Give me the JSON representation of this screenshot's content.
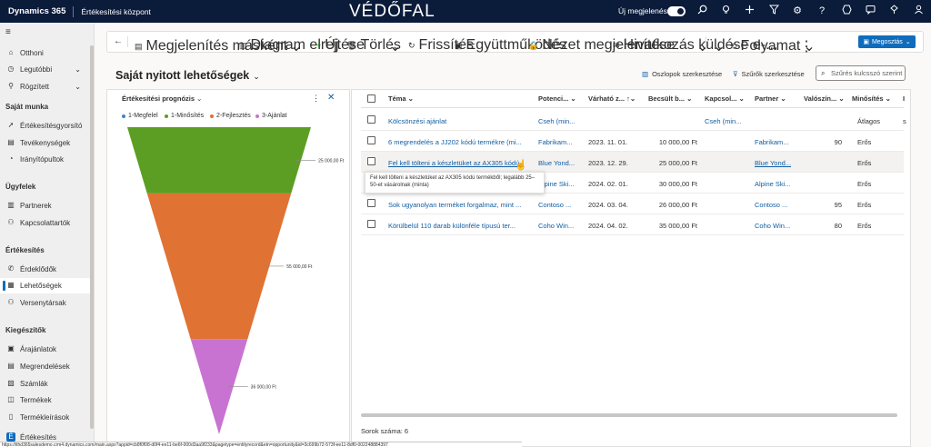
{
  "topbar": {
    "app": "Dynamics 365",
    "area": "Értékesítési központ",
    "brand": "VÉDŐFAL",
    "new_look": "Új megjelenés",
    "icons": [
      "search-icon",
      "lightbulb-icon",
      "plus-icon",
      "filter-icon",
      "gear-icon",
      "help-icon",
      "copilot-icon",
      "chat-icon",
      "remote-icon",
      "user-icon"
    ]
  },
  "sidebar": {
    "top_items": [
      {
        "label": "Otthoni",
        "icon": "home-icon"
      },
      {
        "label": "Legutóbbi",
        "icon": "clock-icon",
        "chevron": true
      },
      {
        "label": "Rögzített",
        "icon": "pin-icon",
        "chevron": true
      }
    ],
    "groups": [
      {
        "title": "Saját munka",
        "items": [
          {
            "label": "Értékesítésgyorsító",
            "icon": "rocket-icon"
          },
          {
            "label": "Tevékenységek",
            "icon": "clipboard-icon"
          },
          {
            "label": "Irányítópultok",
            "icon": "dashboard-icon"
          }
        ]
      },
      {
        "title": "Ügyfelek",
        "items": [
          {
            "label": "Partnerek",
            "icon": "building-icon"
          },
          {
            "label": "Kapcsolattartók",
            "icon": "person-icon"
          }
        ]
      },
      {
        "title": "Értékesítés",
        "items": [
          {
            "label": "Érdeklődők",
            "icon": "phone-icon"
          },
          {
            "label": "Lehetőségek",
            "icon": "opportunity-icon",
            "active": true
          },
          {
            "label": "Versenytársak",
            "icon": "person-icon"
          }
        ]
      },
      {
        "title": "Kiegészítők",
        "items": [
          {
            "label": "Árajánlatok",
            "icon": "quote-icon"
          },
          {
            "label": "Megrendelések",
            "icon": "order-icon"
          },
          {
            "label": "Számlák",
            "icon": "invoice-icon"
          },
          {
            "label": "Termékek",
            "icon": "product-icon"
          },
          {
            "label": "Termékleírások",
            "icon": "document-icon"
          }
        ]
      }
    ],
    "bottom_label": "Értékesítés"
  },
  "commandbar": {
    "items": [
      {
        "label": "Megjelenítés másként",
        "icon": "view-icon"
      },
      {
        "label": "Diagram elrejtése",
        "icon": "chart-icon"
      },
      {
        "label": "Új",
        "icon": "plus-icon"
      },
      {
        "label": "Törlés",
        "icon": "trash-icon"
      },
      {
        "label": "Frissítés",
        "icon": "refresh-icon"
      },
      {
        "label": "Együttműködés",
        "icon": "teams-icon"
      },
      {
        "label": "Nézet megjelenítése",
        "icon": "lock-icon"
      },
      {
        "label": "Hivatkozás küldése e-...",
        "icon": "mail-icon"
      },
      {
        "label": "Folyamat",
        "icon": "flow-icon"
      }
    ],
    "share": "Megosztás"
  },
  "view": {
    "title": "Saját nyitott lehetőségek",
    "edit_columns": "Oszlopok szerkesztése",
    "edit_filters": "Szűrők szerkesztése",
    "search_placeholder": "Szűrés kulcsszó szerint"
  },
  "chart": {
    "title": "Értékesítési prognózis",
    "colors": {
      "megfelel": "#3b86c8",
      "minosites": "#5c9e24",
      "fejlesztes": "#e07234",
      "ajanlat": "#c873d2"
    }
  },
  "chart_data": {
    "type": "funnel",
    "title": "Értékesítési prognózis",
    "legend": [
      "1-Megfelel",
      "1-Minősítés",
      "2-Fejlesztés",
      "3-Ajánlat"
    ],
    "stages": [
      {
        "name": "1-Minősítés",
        "value": 25000,
        "label": "25 000,00 Ft"
      },
      {
        "name": "2-Fejlesztés",
        "value": 55000,
        "label": "55 000,00 Ft"
      },
      {
        "name": "3-Ajánlat",
        "value": 36000,
        "label": "36 000,00 Ft"
      }
    ]
  },
  "grid": {
    "headers": [
      "Téma",
      "Potenci...",
      "Várható z...",
      "Becsült b...",
      "Kapcsol...",
      "Partner",
      "Valószín...",
      "Minősítés",
      "I"
    ],
    "rows": [
      {
        "tema": "Kölcsönzési ajánlat",
        "potenci": "Cseh (min...",
        "varhato": "",
        "becsult": "",
        "kapcsol": "Cseh (min...",
        "partner": "",
        "valoszin": "",
        "minosites": "Átlagos",
        "extra": "s"
      },
      {
        "tema": "6 megrendelés a JJ202 kódú termékre (mi...",
        "potenci": "Fabrikam...",
        "varhato": "2023. 11. 01.",
        "becsult": "10 000,00 Ft",
        "kapcsol": "",
        "partner": "Fabrikam...",
        "valoszin": "90",
        "minosites": "Erős",
        "extra": ""
      },
      {
        "tema": "Fel kell tölteni a készletüket az AX305 kódú",
        "potenci": "Blue Yond...",
        "varhato": "2023. 12. 29.",
        "becsult": "25 000,00 Ft",
        "kapcsol": "",
        "partner": "Blue Yond...",
        "valoszin": "",
        "minosites": "Erős",
        "extra": ""
      },
      {
        "tema": "",
        "potenci": "Alpine Ski...",
        "varhato": "2024. 02. 01.",
        "becsult": "30 000,00 Ft",
        "kapcsol": "",
        "partner": "Alpine Ski...",
        "valoszin": "",
        "minosites": "Erős",
        "extra": ""
      },
      {
        "tema": "Sok ugyanolyan terméket forgalmaz, mint ...",
        "potenci": "Contoso ...",
        "varhato": "2024. 03. 04.",
        "becsult": "26 000,00 Ft",
        "kapcsol": "",
        "partner": "Contoso ...",
        "valoszin": "95",
        "minosites": "Erős",
        "extra": ""
      },
      {
        "tema": "Körülbelül 110 darab különféle típusú ter...",
        "potenci": "Coho Win...",
        "varhato": "2024. 04. 02.",
        "becsult": "35 000,00 Ft",
        "kapcsol": "",
        "partner": "Coho Win...",
        "valoszin": "80",
        "minosites": "Erős",
        "extra": ""
      }
    ],
    "tooltip": "Fel kell tölteni a készletüket az AX305 kódú termékből; legalább 25–50-et vásárolnak (minta)",
    "row_count": "Sorok száma: 6"
  },
  "status_url": "https://ithd365salesdemo.crm4.dynamics.com/main.aspx?appid=cb8f0f08-d0f4-ee11-be6f-000d3aa9f233&pagetype=entityrecord&etn=opportunity&id=3c699b72-573f-ee11-8df0-002248884397"
}
